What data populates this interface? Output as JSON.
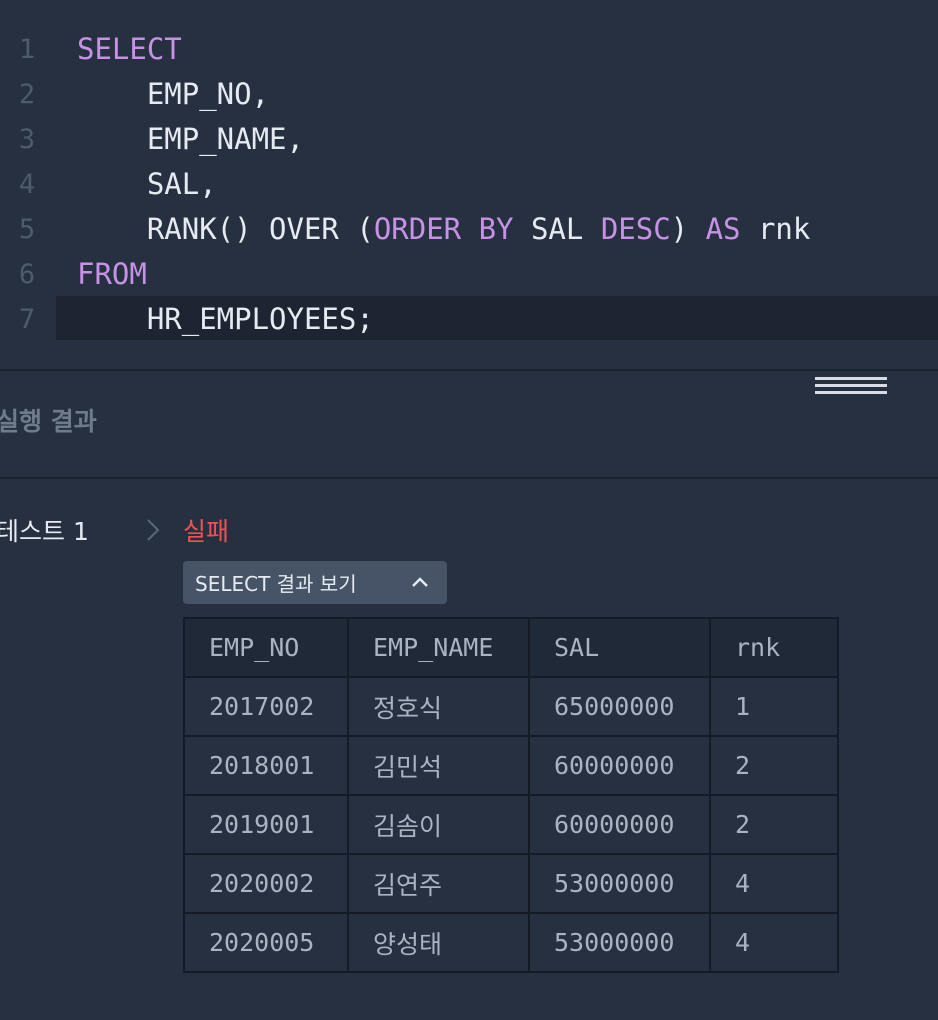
{
  "editor": {
    "lines": [
      {
        "num": "1",
        "tokens": [
          {
            "t": "SELECT",
            "kw": true
          }
        ]
      },
      {
        "num": "2",
        "tokens": [
          {
            "t": "    EMP_NO,",
            "kw": false
          }
        ]
      },
      {
        "num": "3",
        "tokens": [
          {
            "t": "    EMP_NAME,",
            "kw": false
          }
        ]
      },
      {
        "num": "4",
        "tokens": [
          {
            "t": "    SAL,",
            "kw": false
          }
        ]
      },
      {
        "num": "5",
        "tokens": [
          {
            "t": "    RANK() OVER (",
            "kw": false
          },
          {
            "t": "ORDER BY",
            "kw": true
          },
          {
            "t": " SAL ",
            "kw": false
          },
          {
            "t": "DESC",
            "kw": true
          },
          {
            "t": ") ",
            "kw": false
          },
          {
            "t": "AS",
            "kw": true
          },
          {
            "t": " rnk",
            "kw": false
          }
        ]
      },
      {
        "num": "6",
        "tokens": [
          {
            "t": "FROM",
            "kw": true
          }
        ]
      },
      {
        "num": "7",
        "tokens": [
          {
            "t": "    HR_EMPLOYEES;",
            "kw": false
          }
        ]
      }
    ],
    "active_line": "7",
    "keyword_color": "#c792e6"
  },
  "result": {
    "section_title": "실행 결과",
    "test_label": "테스트 1",
    "status": "실패",
    "status_color": "#f05252",
    "toggle_label": "SELECT 결과 보기",
    "table": {
      "headers": [
        "EMP_NO",
        "EMP_NAME",
        "SAL",
        "rnk"
      ],
      "rows": [
        [
          "2017002",
          "정호식",
          "65000000",
          "1"
        ],
        [
          "2018001",
          "김민석",
          "60000000",
          "2"
        ],
        [
          "2019001",
          "김솜이",
          "60000000",
          "2"
        ],
        [
          "2020002",
          "김연주",
          "53000000",
          "4"
        ],
        [
          "2020005",
          "양성태",
          "53000000",
          "4"
        ]
      ]
    }
  },
  "icons": {
    "drag_handle": "drag-handle-icon",
    "chevron_right": "chevron-right-icon",
    "chevron_up": "chevron-up-icon"
  }
}
